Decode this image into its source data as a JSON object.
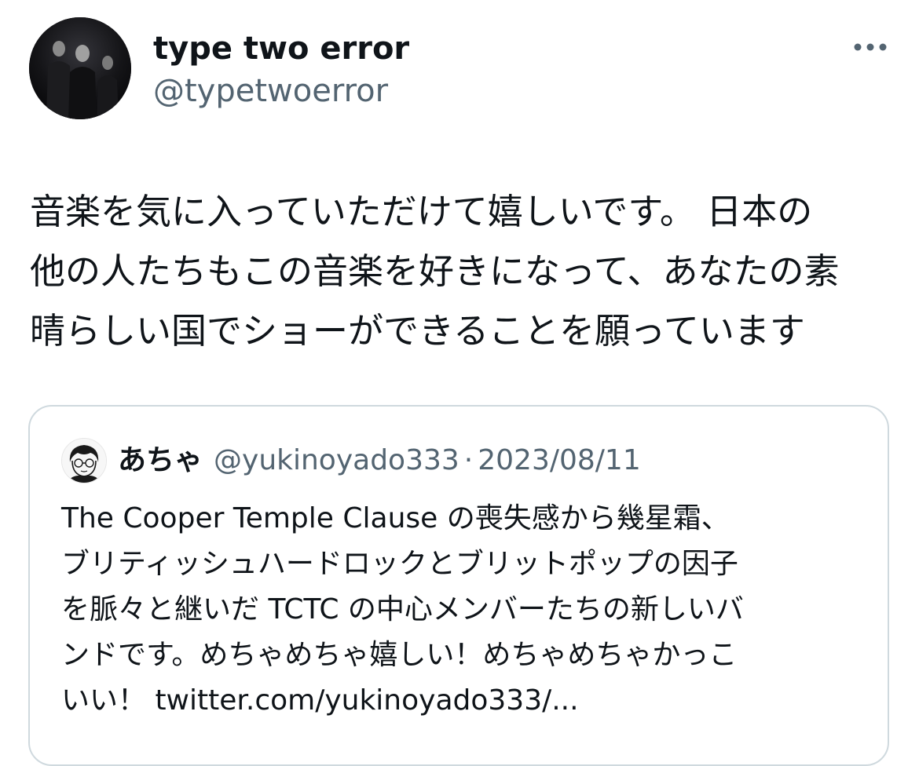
{
  "author": {
    "display_name": "type two error",
    "handle": "@typetwoerror",
    "avatar_icon": "band-photo-avatar"
  },
  "more_icon": "more-options-icon",
  "tweet": {
    "lines": [
      "音楽を気に入っていただけて嬉しいです。 日本の",
      "他の人たちもこの音楽を好きになって、あなたの素",
      "晴らしい国でショーができることを願っています"
    ]
  },
  "quote": {
    "display_name": "あちゃ",
    "handle": "@yukinoyado333",
    "separator": "·",
    "date": "2023/08/11",
    "lines": [
      "The Cooper Temple Clause の喪失感から幾星霜、",
      "ブリティッシュハードロックとブリットポップの因子",
      "を脈々と継いだ TCTC の中心メンバーたちの新しいバ",
      "ンドです。めちゃめちゃ嬉しい！めちゃめちゃかっこ",
      "いい！ twitter.com/yukinoyado333/..."
    ]
  },
  "colors": {
    "text_primary": "#0f1419",
    "text_secondary": "#536471",
    "card_border": "#cfd9de",
    "background": "#ffffff"
  }
}
